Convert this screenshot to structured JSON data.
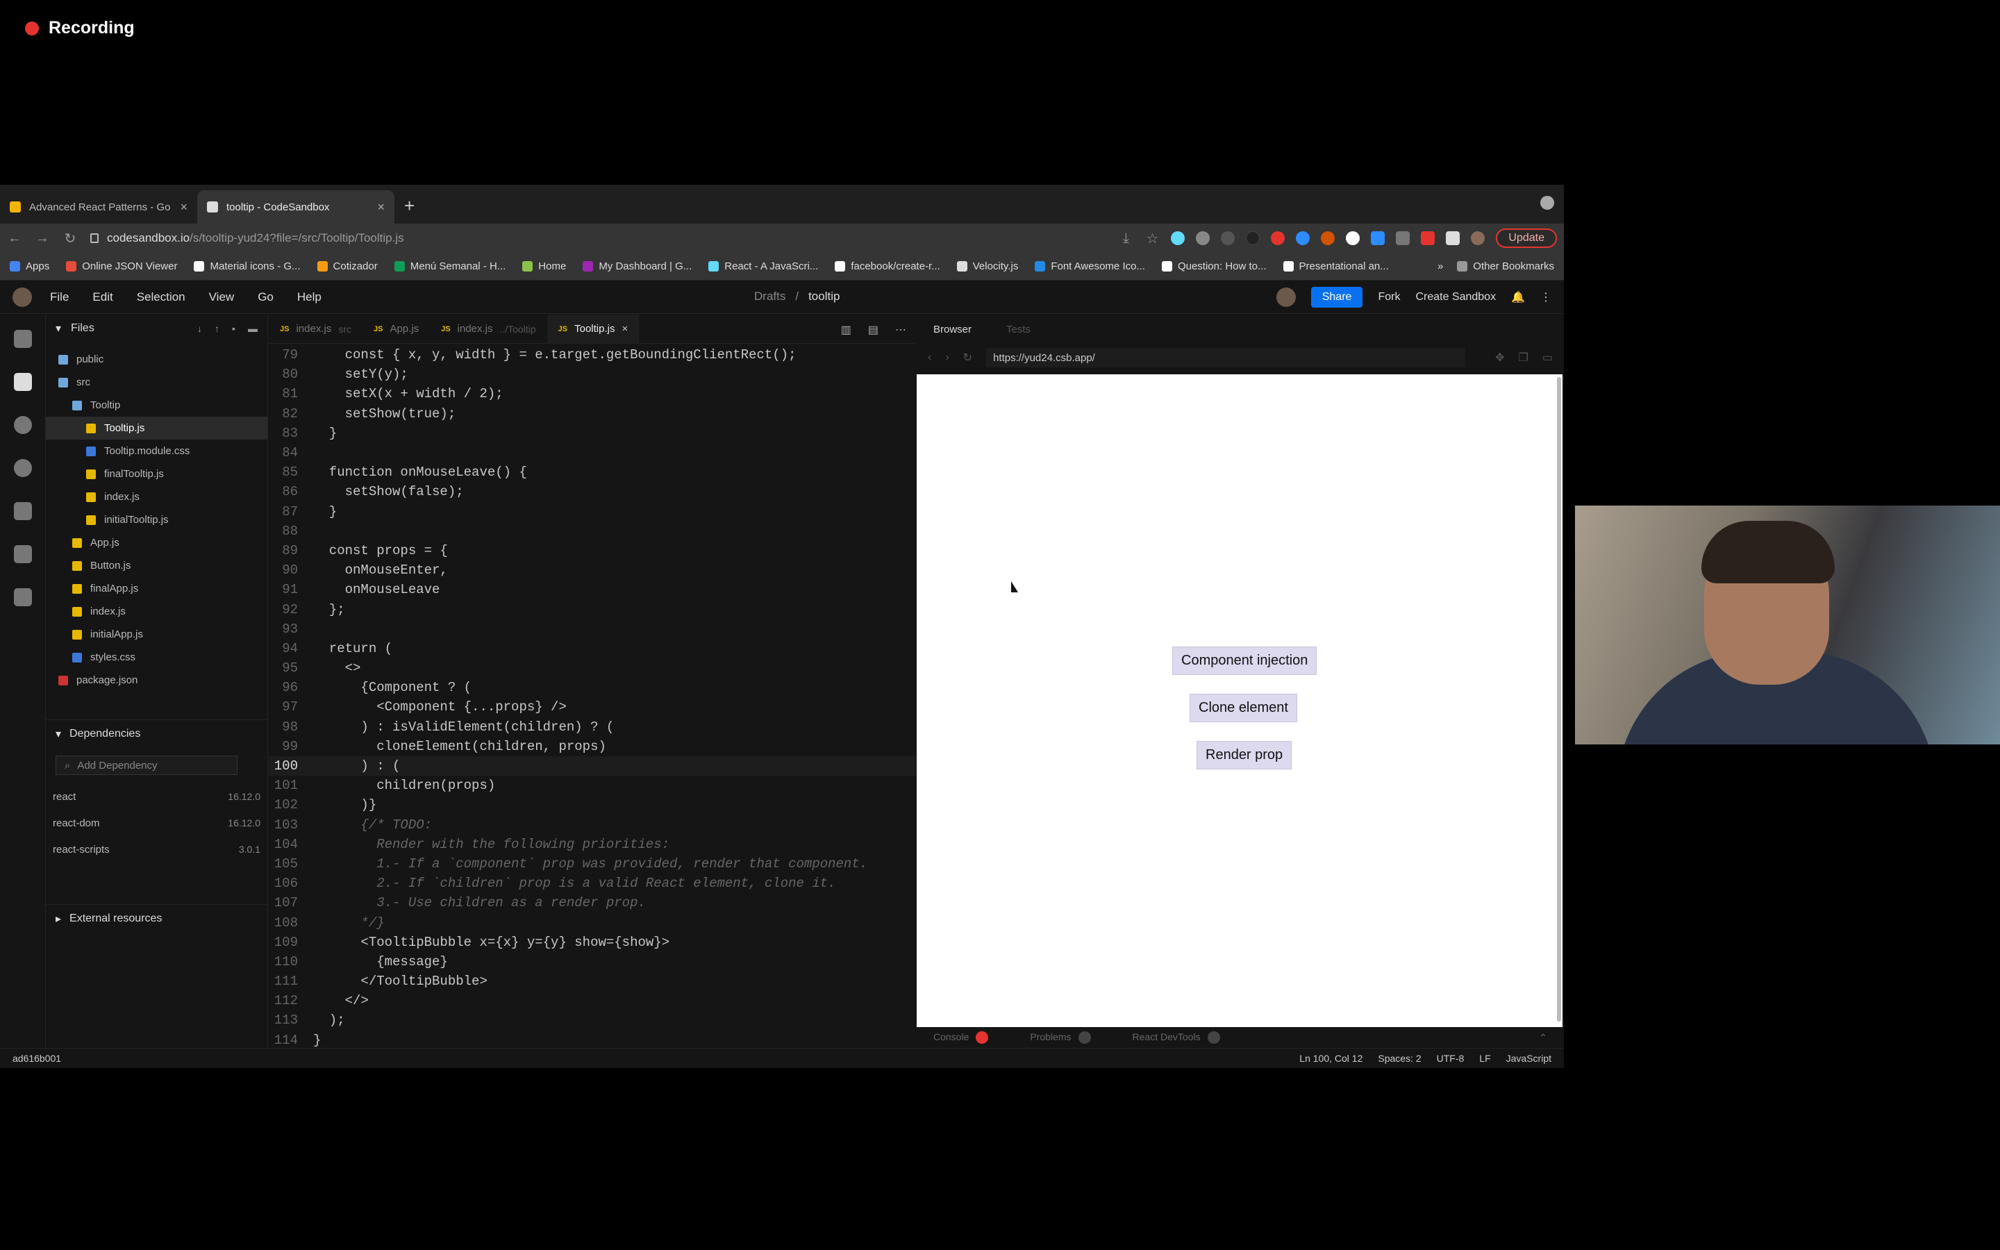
{
  "recording": {
    "label": "Recording"
  },
  "browser": {
    "tabs": [
      {
        "title": "Advanced React Patterns - Go",
        "active": false,
        "icon": "slides-icon",
        "color": "#f4b400"
      },
      {
        "title": "tooltip - CodeSandbox",
        "active": true,
        "icon": "codesandbox-icon",
        "color": "#dddddd"
      }
    ],
    "address": {
      "host": "codesandbox.io",
      "path": "/s/tooltip-yud24?file=/src/Tooltip/Tooltip.js"
    },
    "update_label": "Update",
    "bookmarks": [
      {
        "label": "Apps",
        "color": "#4285f4"
      },
      {
        "label": "Online JSON Viewer",
        "color": "#e74c3c"
      },
      {
        "label": "Material icons - G...",
        "color": "#ffffff"
      },
      {
        "label": "Cotizador",
        "color": "#f39c12"
      },
      {
        "label": "Menú Semanal - H...",
        "color": "#0f9d58"
      },
      {
        "label": "Home",
        "color": "#8bc34a"
      },
      {
        "label": "My Dashboard | G...",
        "color": "#9c27b0"
      },
      {
        "label": "React - A JavaScri...",
        "color": "#61dafb"
      },
      {
        "label": "facebook/create-r...",
        "color": "#ffffff"
      },
      {
        "label": "Velocity.js",
        "color": "#dddddd"
      },
      {
        "label": "Font Awesome Ico...",
        "color": "#228ae6"
      },
      {
        "label": "Question: How to...",
        "color": "#ffffff"
      },
      {
        "label": "Presentational an...",
        "color": "#ffffff"
      }
    ],
    "bookmarks_more": "»",
    "other_bookmarks": "Other Bookmarks"
  },
  "csb": {
    "menu": [
      "File",
      "Edit",
      "Selection",
      "View",
      "Go",
      "Help"
    ],
    "breadcrumb": {
      "parent": "Drafts",
      "sep": "/",
      "current": "tooltip"
    },
    "share": "Share",
    "fork": "Fork",
    "create": "Create Sandbox",
    "explorer": {
      "title": "Files",
      "files": [
        {
          "name": "public",
          "type": "folder",
          "indent": 0
        },
        {
          "name": "src",
          "type": "folder",
          "indent": 0
        },
        {
          "name": "Tooltip",
          "type": "folder",
          "indent": 1
        },
        {
          "name": "Tooltip.js",
          "type": "js",
          "indent": 2,
          "active": true
        },
        {
          "name": "Tooltip.module.css",
          "type": "css",
          "indent": 2
        },
        {
          "name": "finalTooltip.js",
          "type": "js",
          "indent": 2
        },
        {
          "name": "index.js",
          "type": "js",
          "indent": 2
        },
        {
          "name": "initialTooltip.js",
          "type": "js",
          "indent": 2
        },
        {
          "name": "App.js",
          "type": "js",
          "indent": 1
        },
        {
          "name": "Button.js",
          "type": "js",
          "indent": 1
        },
        {
          "name": "finalApp.js",
          "type": "js",
          "indent": 1
        },
        {
          "name": "index.js",
          "type": "js",
          "indent": 1
        },
        {
          "name": "initialApp.js",
          "type": "js",
          "indent": 1
        },
        {
          "name": "styles.css",
          "type": "css",
          "indent": 1
        },
        {
          "name": "package.json",
          "type": "pkg",
          "indent": 0
        }
      ],
      "dependencies_title": "Dependencies",
      "add_dependency_placeholder": "Add Dependency",
      "dependencies": [
        {
          "name": "react",
          "version": "16.12.0"
        },
        {
          "name": "react-dom",
          "version": "16.12.0"
        },
        {
          "name": "react-scripts",
          "version": "3.0.1"
        }
      ],
      "external_title": "External resources"
    },
    "editor_tabs": [
      {
        "name": "index.js",
        "sub": "src",
        "active": false
      },
      {
        "name": "App.js",
        "sub": "",
        "active": false
      },
      {
        "name": "index.js",
        "sub": "../Tooltip",
        "active": false
      },
      {
        "name": "Tooltip.js",
        "sub": "",
        "active": true
      }
    ],
    "code_lines": [
      {
        "n": "79",
        "t": "    const { x, y, width } = e.target.getBoundingClientRect();"
      },
      {
        "n": "80",
        "t": "    setY(y);"
      },
      {
        "n": "81",
        "t": "    setX(x + width / 2);"
      },
      {
        "n": "82",
        "t": "    setShow(true);"
      },
      {
        "n": "83",
        "t": "  }"
      },
      {
        "n": "84",
        "t": ""
      },
      {
        "n": "85",
        "t": "  function onMouseLeave() {"
      },
      {
        "n": "86",
        "t": "    setShow(false);"
      },
      {
        "n": "87",
        "t": "  }"
      },
      {
        "n": "88",
        "t": ""
      },
      {
        "n": "89",
        "t": "  const props = {"
      },
      {
        "n": "90",
        "t": "    onMouseEnter,"
      },
      {
        "n": "91",
        "t": "    onMouseLeave"
      },
      {
        "n": "92",
        "t": "  };"
      },
      {
        "n": "93",
        "t": ""
      },
      {
        "n": "94",
        "t": "  return ("
      },
      {
        "n": "95",
        "t": "    <>"
      },
      {
        "n": "96",
        "t": "      {Component ? ("
      },
      {
        "n": "97",
        "t": "        <Component {...props} />"
      },
      {
        "n": "98",
        "t": "      ) : isValidElement(children) ? ("
      },
      {
        "n": "99",
        "t": "        cloneElement(children, props)"
      },
      {
        "n": "100",
        "t": "      ) : (",
        "current": true
      },
      {
        "n": "101",
        "t": "        children(props)"
      },
      {
        "n": "102",
        "t": "      )}"
      },
      {
        "n": "103",
        "t": "      {/* TODO:",
        "comment": true
      },
      {
        "n": "104",
        "t": "        Render with the following priorities:",
        "comment": true
      },
      {
        "n": "105",
        "t": "        1.- If a `component` prop was provided, render that component.",
        "comment": true
      },
      {
        "n": "106",
        "t": "        2.- If `children` prop is a valid React element, clone it.",
        "comment": true
      },
      {
        "n": "107",
        "t": "        3.- Use children as a render prop.",
        "comment": true
      },
      {
        "n": "108",
        "t": "      */}",
        "comment": true
      },
      {
        "n": "109",
        "t": "      <TooltipBubble x={x} y={y} show={show}>"
      },
      {
        "n": "110",
        "t": "        {message}"
      },
      {
        "n": "111",
        "t": "      </TooltipBubble>"
      },
      {
        "n": "112",
        "t": "    </>"
      },
      {
        "n": "113",
        "t": "  );"
      },
      {
        "n": "114",
        "t": "}"
      }
    ],
    "preview": {
      "tab_browser": "Browser",
      "tab_tests": "Tests",
      "url": "https://yud24.csb.app/",
      "buttons": [
        "Component injection",
        "Clone element",
        "Render prop"
      ],
      "bottom": {
        "console": "Console",
        "problems": "Problems",
        "devtools": "React DevTools"
      }
    },
    "status": {
      "commit": "ad616b001",
      "position": "Ln 100, Col 12",
      "spaces": "Spaces: 2",
      "encoding": "UTF-8",
      "eol": "LF",
      "language": "JavaScript"
    }
  }
}
